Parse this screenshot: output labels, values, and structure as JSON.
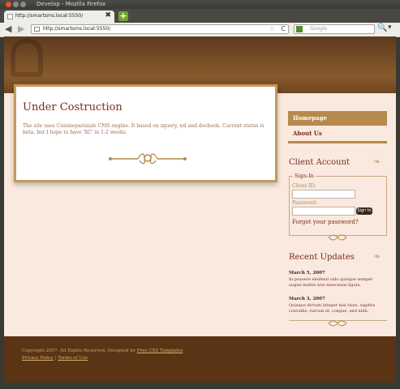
{
  "window": {
    "title": "Develop - Mozilla Firefox"
  },
  "tab": {
    "label": "http://smartsms.local:5550/",
    "close_glyph": "✖",
    "newtab_glyph": "+"
  },
  "nav": {
    "back_glyph": "◀",
    "forward_glyph": "▶",
    "url": "http://smartsms.local:5550/",
    "star_glyph": "☆",
    "reload_glyph": "C",
    "search_placeholder": "Google",
    "search_glyph": "🔍",
    "menu_glyph": "▾"
  },
  "content": {
    "title": "Under Costruction",
    "text": "The site uses Cuisineparisiale CMS engine. It based on zquery, xsl and docbook. Current status is beta, but I hope to have 'XC' in 1-2 weeks.",
    "ornament_glyph": "❦"
  },
  "menu": {
    "items": [
      "Homepage",
      "About Us"
    ]
  },
  "client": {
    "title": "Client Account",
    "legend": "Sign-In",
    "client_id_label": "Client ID:",
    "password_label": "Password:",
    "signin_label": "Sign In",
    "forgot_label": "Forgot your password?"
  },
  "updates": {
    "title": "Recent Updates",
    "items": [
      {
        "date": "March 5, 2007",
        "text": "In posuere eleifend odio quisque semper augue mattis wisi maecenas ligula."
      },
      {
        "date": "March 3, 2007",
        "text": "Quisque dictum integer nisl risus, sagittis convallis, rutrum id, congue, and nibh."
      }
    ]
  },
  "footer": {
    "line1_prefix": "Copyright 2007. All Rights Reserved. Designed by ",
    "line1_link": "Free CSS Templates",
    "privacy": "Privacy Policy",
    "sep": " | ",
    "terms": "Terms of Use"
  },
  "colors": {
    "brand_brown": "#5a3415",
    "accent_gold": "#b7894c",
    "heading_red": "#7a2b1a",
    "page_bg": "#f9e9de"
  }
}
